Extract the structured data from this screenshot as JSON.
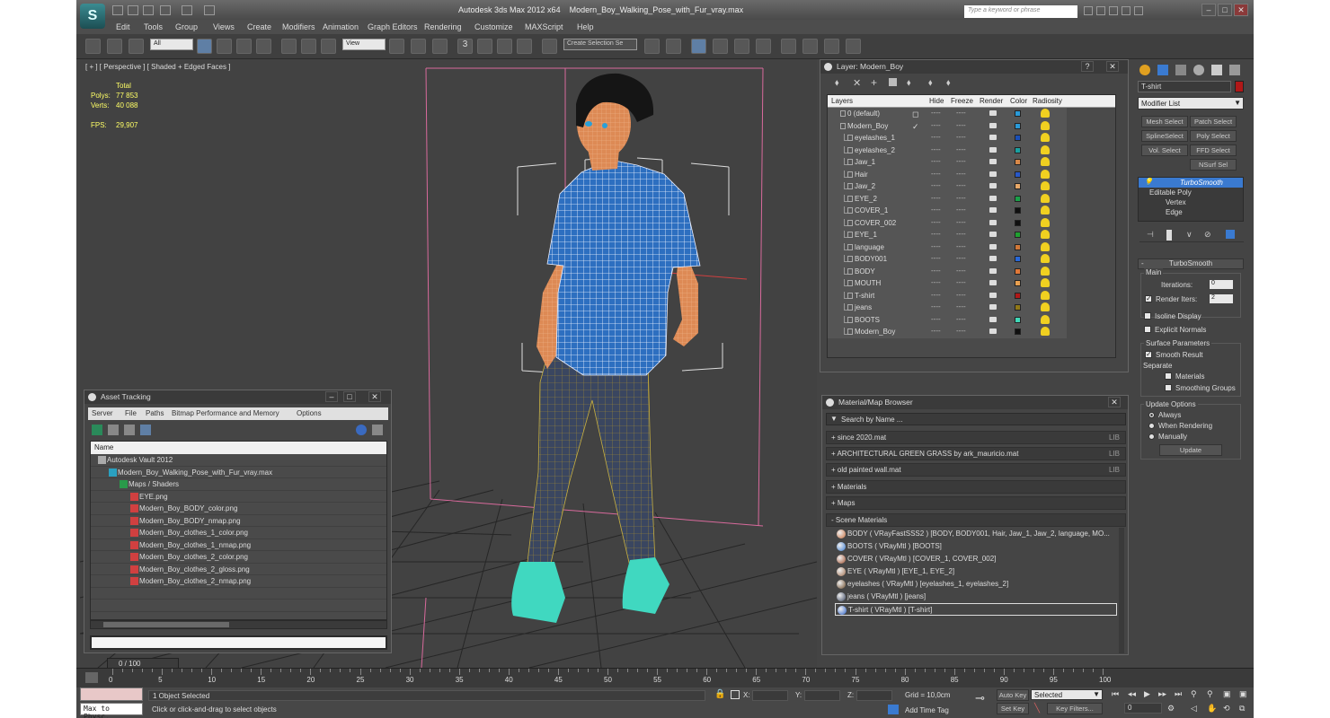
{
  "app": {
    "title": "Autodesk 3ds Max  2012 x64",
    "file": "Modern_Boy_Walking_Pose_with_Fur_vray.max",
    "search_placeholder": "Type a keyword or phrase",
    "logo": "S"
  },
  "menus": [
    "Edit",
    "Tools",
    "Group",
    "Views",
    "Create",
    "Modifiers",
    "Animation",
    "Graph Editors",
    "Rendering",
    "Customize",
    "MAXScript",
    "Help"
  ],
  "toolbar": {
    "filter": "All",
    "ref_coord": "View",
    "selection_set": "Create Selection Se",
    "snap_label": "3"
  },
  "viewport": {
    "label": "[ + ] [ Perspective ] [ Shaded + Edged Faces ]",
    "stats": {
      "total_label": "Total",
      "polys_label": "Polys:",
      "polys": "77 853",
      "verts_label": "Verts:",
      "verts": "40 088",
      "fps_label": "FPS:",
      "fps": "29,907"
    }
  },
  "layer_panel": {
    "title": "Layer: Modern_Boy",
    "columns": [
      "Layers",
      "Hide",
      "Freeze",
      "Render",
      "Color",
      "Radiosity"
    ],
    "layers": [
      {
        "name": "0 (default)",
        "level": 0,
        "color": "#2a9ad8",
        "check": "◻"
      },
      {
        "name": "Modern_Boy",
        "level": 0,
        "color": "#2a9ad8",
        "check": "✓"
      },
      {
        "name": "eyelashes_1",
        "level": 1,
        "color": "#1a4fb8",
        "check": ""
      },
      {
        "name": "eyelashes_2",
        "level": 1,
        "color": "#1aa0a0",
        "check": ""
      },
      {
        "name": "Jaw_1",
        "level": 1,
        "color": "#d88848",
        "check": ""
      },
      {
        "name": "Hair",
        "level": 1,
        "color": "#2858c8",
        "check": ""
      },
      {
        "name": "Jaw_2",
        "level": 1,
        "color": "#e8a868",
        "check": ""
      },
      {
        "name": "EYE_2",
        "level": 1,
        "color": "#1aa048",
        "check": ""
      },
      {
        "name": "COVER_1",
        "level": 1,
        "color": "#101010",
        "check": ""
      },
      {
        "name": "COVER_002",
        "level": 1,
        "color": "#101010",
        "check": ""
      },
      {
        "name": "EYE_1",
        "level": 1,
        "color": "#20a030",
        "check": ""
      },
      {
        "name": "language",
        "level": 1,
        "color": "#d07838",
        "check": ""
      },
      {
        "name": "BODY001",
        "level": 1,
        "color": "#2868d8",
        "check": ""
      },
      {
        "name": "BODY",
        "level": 1,
        "color": "#e07838",
        "check": ""
      },
      {
        "name": "MOUTH",
        "level": 1,
        "color": "#e8a050",
        "check": ""
      },
      {
        "name": "T-shirt",
        "level": 1,
        "color": "#b01818",
        "check": ""
      },
      {
        "name": "jeans",
        "level": 1,
        "color": "#907818",
        "check": ""
      },
      {
        "name": "BOOTS",
        "level": 1,
        "color": "#40d8b8",
        "check": ""
      },
      {
        "name": "Modern_Boy",
        "level": 1,
        "color": "#101010",
        "check": ""
      }
    ]
  },
  "asset_panel": {
    "title": "Asset Tracking",
    "menus": [
      "Server",
      "File",
      "Paths",
      "Bitmap Performance and Memory",
      "Options"
    ],
    "col_name": "Name",
    "items": [
      {
        "label": "Autodesk Vault 2012",
        "indent": 18,
        "icon": "vault"
      },
      {
        "label": "Modern_Boy_Walking_Pose_with_Fur_vray.max",
        "indent": 30,
        "icon": "max"
      },
      {
        "label": "Maps / Shaders",
        "indent": 42,
        "icon": "maps"
      },
      {
        "label": "EYE.png",
        "indent": 54,
        "icon": "img"
      },
      {
        "label": "Modern_Boy_BODY_color.png",
        "indent": 54,
        "icon": "img"
      },
      {
        "label": "Modern_Boy_BODY_nmap.png",
        "indent": 54,
        "icon": "img"
      },
      {
        "label": "Modern_Boy_clothes_1_color.png",
        "indent": 54,
        "icon": "img"
      },
      {
        "label": "Modern_Boy_clothes_1_nmap.png",
        "indent": 54,
        "icon": "img"
      },
      {
        "label": "Modern_Boy_clothes_2_color.png",
        "indent": 54,
        "icon": "img"
      },
      {
        "label": "Modern_Boy_clothes_2_gloss.png",
        "indent": 54,
        "icon": "img"
      },
      {
        "label": "Modern_Boy_clothes_2_nmap.png",
        "indent": 54,
        "icon": "img"
      }
    ]
  },
  "material_panel": {
    "title": "Material/Map Browser",
    "search": "Search by Name ...",
    "groups": [
      {
        "label": "+ since 2020.mat",
        "lib": "LIB"
      },
      {
        "label": "+ ARCHITECTURAL GREEN GRASS by ark_mauricio.mat",
        "lib": "LIB"
      },
      {
        "label": "+ old painted wall.mat",
        "lib": "LIB"
      },
      {
        "label": "+ Materials",
        "lib": ""
      },
      {
        "label": "+ Maps",
        "lib": ""
      },
      {
        "label": "- Scene Materials",
        "lib": ""
      }
    ],
    "scene_materials": [
      "BODY  ( VRayFastSSS2 ) [BODY, BODY001, Hair, Jaw_1, Jaw_2, language, MO...",
      "BOOTS  ( VRayMtl ) [BOOTS]",
      "COVER  ( VRayMtl ) [COVER_1, COVER_002]",
      "EYE  ( VRayMtl ) [EYE_1, EYE_2]",
      "eyelashes  ( VRayMtl ) [eyelashes_1, eyelashes_2]",
      "jeans  ( VRayMtl ) [jeans]",
      "T-shirt  ( VRayMtl ) [T-shirt]"
    ]
  },
  "command_panel": {
    "object_name": "T-shirt",
    "modifier_list": "Modifier List",
    "buttons": [
      "Mesh Select",
      "Patch Select",
      "SplineSelect",
      "Poly Select",
      "Vol. Select",
      "FFD Select",
      "NSurf Sel"
    ],
    "stack": [
      "TurboSmooth",
      "Editable Poly",
      "Vertex",
      "Edge"
    ],
    "turbosmooth": {
      "title": "TurboSmooth",
      "main": "Main",
      "iterations_label": "Iterations:",
      "iterations": "0",
      "render_iters_label": "Render Iters:",
      "render_iters": "2",
      "isoline": "Isoline Display",
      "explicit": "Explicit Normals",
      "surface": "Surface Parameters",
      "smooth": "Smooth Result",
      "separate": "Separate",
      "materials": "Materials",
      "smoothing": "Smoothing Groups",
      "update_options": "Update Options",
      "always": "Always",
      "when_rendering": "When Rendering",
      "manually": "Manually",
      "update": "Update"
    }
  },
  "timeline": {
    "frame": "0 / 100",
    "ticks": [
      "0",
      "5",
      "10",
      "15",
      "20",
      "25",
      "30",
      "35",
      "40",
      "45",
      "50",
      "55",
      "60",
      "65",
      "70",
      "75",
      "80",
      "85",
      "90",
      "95",
      "100"
    ]
  },
  "statusbar": {
    "maxscript": "Max to Physc.",
    "selected": "1 Object Selected",
    "prompt": "Click or click-and-drag to select objects",
    "x_label": "X:",
    "y_label": "Y:",
    "z_label": "Z:",
    "grid": "Grid = 10,0cm",
    "add_time_tag": "Add Time Tag",
    "auto_key": "Auto Key",
    "set_key": "Set Key",
    "key_mode": "Selected",
    "key_filters": "Key Filters...",
    "frame": "0"
  },
  "colors": {
    "accent": "#5f7fa5",
    "shirt_wire": "#2d6fc0",
    "skin": "#dd8a55",
    "boots": "#40d8c0",
    "jeans": "#3a4660"
  }
}
